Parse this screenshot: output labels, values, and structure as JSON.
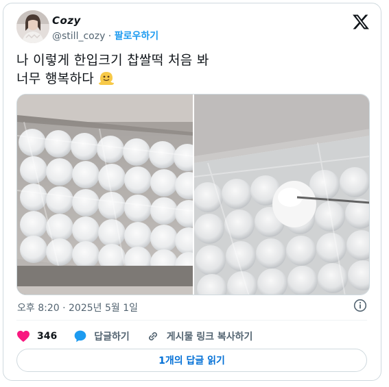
{
  "author": {
    "display_name": "Cozy",
    "handle": "@still_cozy",
    "separator": " · ",
    "follow_label": "팔로우하기"
  },
  "tweet": {
    "line1": "나 이렇게 한입크기 찹쌀떡 처음 봐",
    "line2": "너무 행복하다",
    "emoji": "melting-face-emoji",
    "timestamp": "오후 8:20 · 2025년 5월 1일"
  },
  "actions": {
    "like_count": "346",
    "reply_label": "답글하기",
    "copy_link_label": "게시물 링크 복사하기"
  },
  "read_replies_label": "1개의 답글 읽기",
  "colors": {
    "accent": "#1d9bf0",
    "like": "#f91880",
    "muted": "#536471",
    "border": "#cfd9de"
  }
}
